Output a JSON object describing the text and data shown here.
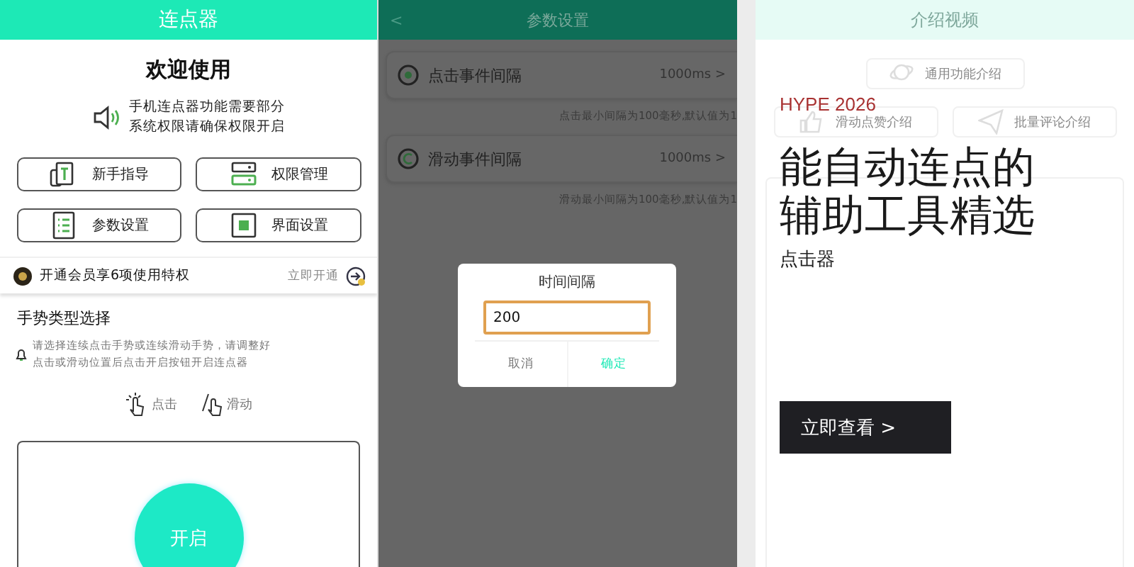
{
  "main_screen": {
    "title": "连点器",
    "welcome": "欢迎使用",
    "notice": [
      "手机连点器功能需要部分",
      "系统权限请确保权限开启"
    ],
    "feature_buttons": [
      {
        "label": "新手指导"
      },
      {
        "label": "权限管理"
      },
      {
        "label": "参数设置"
      },
      {
        "label": "界面设置"
      }
    ],
    "vip_bar": {
      "text": "开通会员享6项使用特权",
      "action": "立即开通"
    },
    "gesture_section": {
      "heading": "手势类型选择",
      "hint": [
        "请选择连续点击手势或连续滑动手势，请调整好",
        "点击或滑动位置后点击开启按钮开启连点器"
      ],
      "options": [
        {
          "label": "点击"
        },
        {
          "label": "滑动"
        }
      ]
    },
    "start_button": "开启"
  },
  "settings_screen": {
    "back": "<",
    "title": "参数设置",
    "rows": [
      {
        "label": "点击事件间隔",
        "value": "1000ms >",
        "note": "点击最小间隔为100毫秒,默认值为1"
      },
      {
        "label": "滑动事件间隔",
        "value": "1000ms >",
        "note": "滑动最小间隔为100毫秒,默认值为1"
      }
    ],
    "dialog": {
      "title": "时间间隔",
      "value": "200",
      "buttons": [
        "取消",
        "确定"
      ]
    }
  },
  "intro_screen": {
    "title": "介绍视频",
    "buttons": [
      {
        "label": "通用功能介绍"
      },
      {
        "label": "滑动点赞介绍"
      },
      {
        "label": "批量评论介绍"
      }
    ]
  },
  "promo_overlay": {
    "tag": "HYPE 2026",
    "headline": [
      "能自动连点的",
      "辅助工具精选"
    ],
    "subtitle": "点击器",
    "cta": "立即查看 >"
  }
}
